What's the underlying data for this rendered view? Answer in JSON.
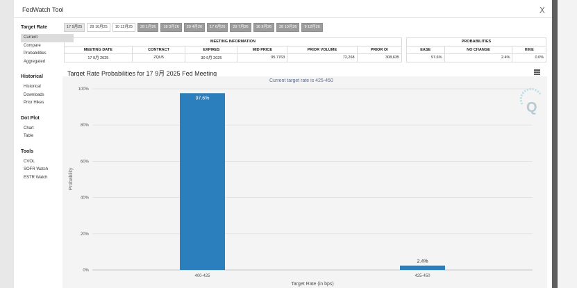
{
  "window": {
    "title": "FedWatch Tool",
    "close_glyph": "X"
  },
  "sidebar": {
    "sections": [
      {
        "heading": "Target Rate",
        "items": [
          "Current",
          "Compare",
          "Probabilities",
          "Aggregated"
        ],
        "active": 0
      },
      {
        "heading": "Historical",
        "items": [
          "Historical",
          "Downloads",
          "Prior Hikes"
        ]
      },
      {
        "heading": "Dot Plot",
        "items": [
          "Chart",
          "Table"
        ]
      },
      {
        "heading": "Tools",
        "items": [
          "CVOL",
          "SOFR Watch",
          "ESTR Watch"
        ]
      }
    ]
  },
  "tabs": {
    "items": [
      "17 9月25",
      "29 10月25",
      "10 12月25",
      "28 1月26",
      "18 3月26",
      "29 4月26",
      "17 6月26",
      "29 7月26",
      "16 9月26",
      "28 10月26",
      "9 12月26"
    ],
    "active": 0,
    "grey_from": 3
  },
  "meeting_info": {
    "title": "MEETING INFORMATION",
    "headers": [
      "MEETING DATE",
      "CONTRACT",
      "EXPIRES",
      "MID PRICE",
      "PRIOR VOLUME",
      "PRIOR OI"
    ],
    "values": [
      "17 9月 2025",
      "ZQU5",
      "30 9月 2025",
      "95.7763",
      "72,268",
      "308,635"
    ]
  },
  "probabilities": {
    "title": "PROBABILITIES",
    "headers": [
      "EASE",
      "NO CHANGE",
      "HIKE"
    ],
    "values": [
      "97.6%",
      "2.4%",
      "0.0%"
    ]
  },
  "chart": {
    "title": "Target Rate Probabilities for 17 9月 2025 Fed Meeting",
    "subtitle": "Current target rate is 425-450",
    "bar_color": "#2b7fbc"
  },
  "chart_data": {
    "type": "bar",
    "title": "Target Rate Probabilities for 17 9月 2025 Fed Meeting",
    "subtitle": "Current target rate is 425-450",
    "categories": [
      "400-425",
      "425-450"
    ],
    "values": [
      97.6,
      2.4
    ],
    "data_labels": [
      "97.6%",
      "2.4%"
    ],
    "xlabel": "Target Rate (in bps)",
    "ylabel": "Probability",
    "ylim": [
      0,
      100
    ],
    "yticks": [
      "0%",
      "20%",
      "40%",
      "60%",
      "80%",
      "100%"
    ],
    "grid": true
  }
}
